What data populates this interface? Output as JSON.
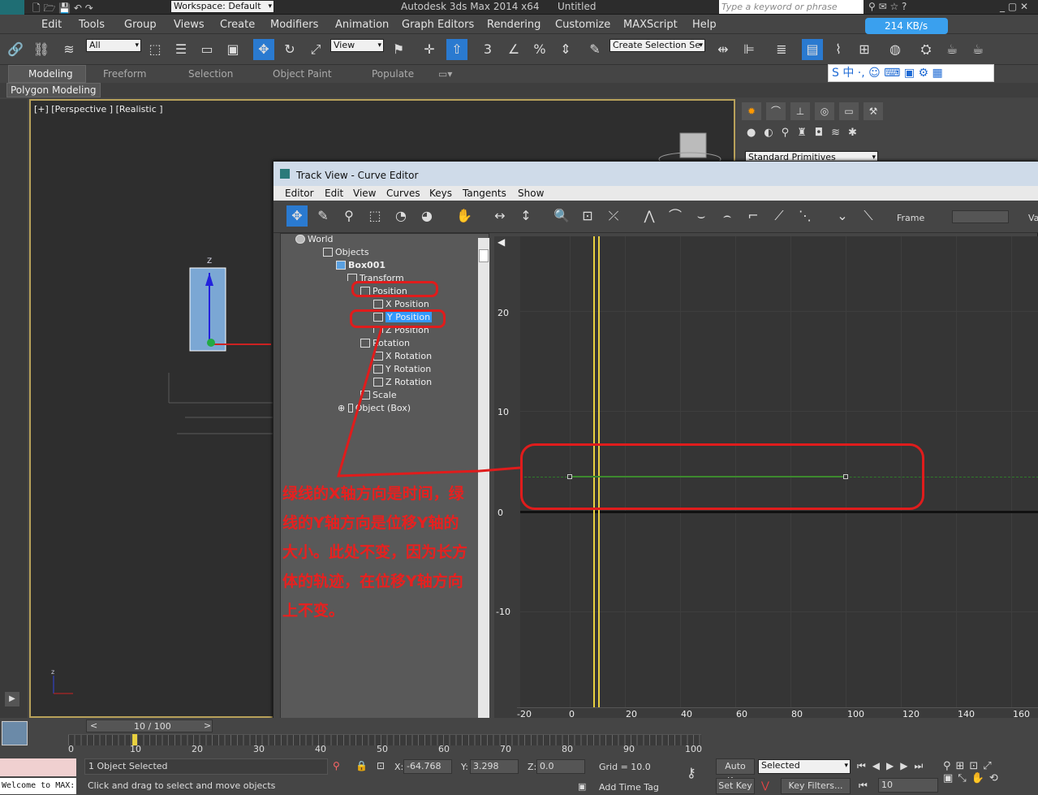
{
  "app": {
    "title": "Autodesk 3ds Max  2014 x64",
    "doc": "Untitled",
    "workspace": "Workspace: Default",
    "search_placeholder": "Type a keyword or phrase",
    "speed": "214 KB/s"
  },
  "menu": [
    "Edit",
    "Tools",
    "Group",
    "Views",
    "Create",
    "Modifiers",
    "Animation",
    "Graph Editors",
    "Rendering",
    "Customize",
    "MAXScript",
    "Help"
  ],
  "toolbar": {
    "filter": "All",
    "refcoord": "View",
    "selset": "Create Selection Se"
  },
  "ribbon": {
    "tabs": [
      "Modeling",
      "Freeform",
      "Selection",
      "Object Paint",
      "Populate"
    ],
    "sub": "Polygon Modeling"
  },
  "viewport": {
    "label": "[+] [Perspective ] [Realistic ]"
  },
  "cmdpanel": {
    "dropdown": "Standard Primitives"
  },
  "curve_editor": {
    "title": "Track View - Curve Editor",
    "menu": [
      "Editor",
      "Edit",
      "View",
      "Curves",
      "Keys",
      "Tangents",
      "Show"
    ],
    "frame_label": "Frame",
    "value_label": "Value",
    "tree": [
      "World",
      "Objects",
      "Box001",
      "Transform",
      "Position",
      "X Position",
      "Y Position",
      "Z Position",
      "Rotation",
      "X Rotation",
      "Y Rotation",
      "Z Rotation",
      "Scale",
      "Object (Box)"
    ],
    "y_labels": [
      "20",
      "10",
      "0",
      "-10"
    ],
    "x_labels": [
      "-20",
      "0",
      "20",
      "40",
      "60",
      "80",
      "100",
      "120",
      "140",
      "160"
    ]
  },
  "annotation": "绿线的X轴方向是时间，绿线的Y轴方向是位移Y轴的大小。此处不变，因为长方体的轨迹，在位移Y轴方向上不变。",
  "timeline": {
    "counter": "10 / 100",
    "ticks": [
      "0",
      "10",
      "20",
      "30",
      "40",
      "50",
      "60",
      "70",
      "80",
      "90",
      "100"
    ]
  },
  "status": {
    "selected": "1 Object Selected",
    "prompt": "Click and drag to select and move objects",
    "x": "-64.768",
    "y": "3.298",
    "z": "0.0",
    "grid": "Grid = 10.0",
    "autokey": "Auto Key",
    "setkey": "Set Key",
    "keymode": "Selected",
    "keyfilters": "Key Filters...",
    "addtime": "Add Time Tag",
    "frame": "10",
    "welcome": "Welcome to MAX:"
  },
  "colors": {
    "annotation_red": "#e01c1c",
    "curve_green": "#3d8a2e",
    "time_slider": "#e8d040",
    "selection_blue": "#3399ff"
  }
}
